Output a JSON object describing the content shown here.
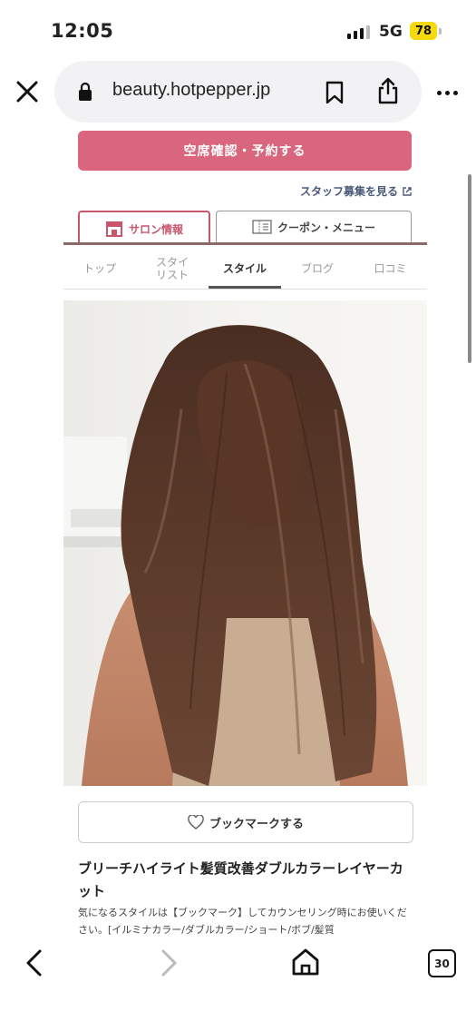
{
  "status_bar": {
    "time": "12:05",
    "network": "5G",
    "battery": "78"
  },
  "browser": {
    "url": "beauty.hotpepper.jp",
    "tab_count": "30"
  },
  "page": {
    "reserve_button": "空席確認・予約する",
    "staff_link": "スタッフ募集を見る",
    "tabs": [
      {
        "label": "サロン情報",
        "icon": "shop-icon"
      },
      {
        "label": "クーポン・メニュー",
        "icon": "menu-book-icon"
      }
    ],
    "subnav": [
      "トップ",
      "スタイ\nリスト",
      "スタイル",
      "ブログ",
      "口コミ"
    ],
    "bookmark_button": "ブックマークする",
    "style_title": "ブリーチハイライト髪質改善ダブルカラーレイヤーカット",
    "style_desc": "気になるスタイルは【ブックマーク】してカウンセリング時にお使いください。[イルミナカラー/ダブルカラー/ショート/ボブ/髪質"
  },
  "colors": {
    "accent": "#d9667c",
    "tab_accent": "#c9566c",
    "battery": "#f5d90a"
  }
}
